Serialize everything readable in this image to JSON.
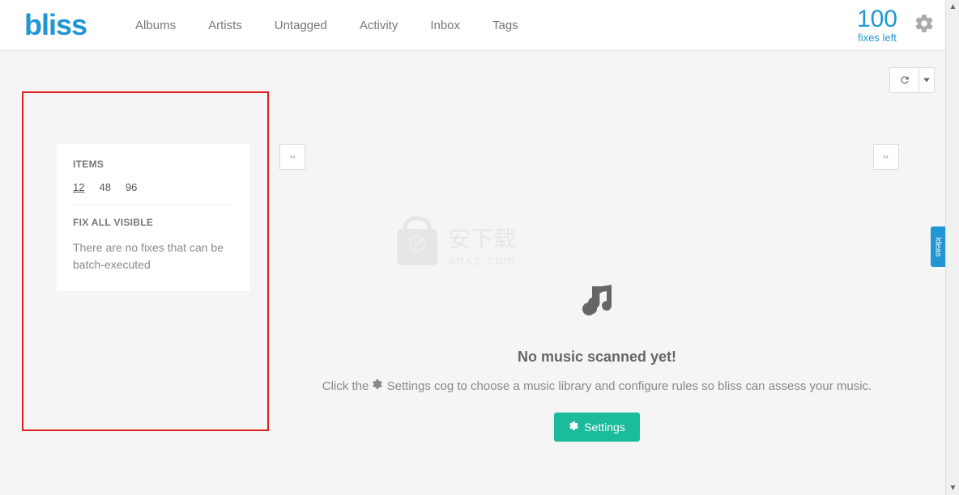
{
  "header": {
    "logo": "bliss",
    "nav": [
      "Albums",
      "Artists",
      "Untagged",
      "Activity",
      "Inbox",
      "Tags"
    ],
    "fixes_count": "100",
    "fixes_label": "fixes left"
  },
  "sidebar": {
    "items_heading": "ITEMS",
    "items_options": [
      "12",
      "48",
      "96"
    ],
    "fix_heading": "FIX ALL VISIBLE",
    "fix_text": "There are no fixes that can be batch-executed"
  },
  "main": {
    "title": "No music scanned yet!",
    "text_before": "Click the ",
    "text_after": " Settings cog to choose a music library and configure rules so bliss can assess your music.",
    "settings_button": "Settings"
  },
  "watermark": {
    "text_cn": "安下载",
    "text_en": "anxz.com"
  },
  "side_tab": "Ideas"
}
